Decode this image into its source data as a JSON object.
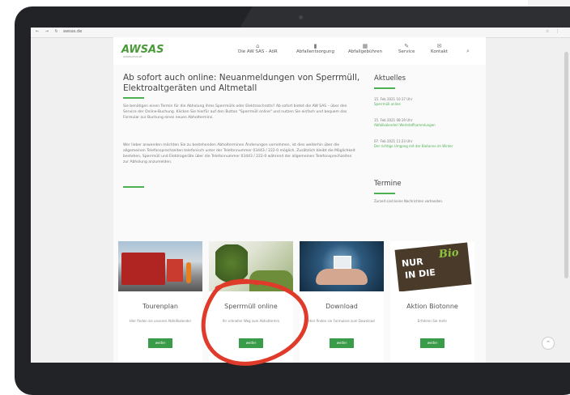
{
  "browser": {
    "nav_glyphs": "← → ↻",
    "url": "awsas.de",
    "ext_glyphs": "☆ ⋮"
  },
  "site": {
    "logo": "AWSAS",
    "logo_sub": "Abfallwirtschaft",
    "menu": [
      {
        "icon": "home-icon",
        "glyph": "⌂",
        "label": "Die AW SAS - AöR"
      },
      {
        "icon": "trash-icon",
        "glyph": "▮",
        "label": "Abfallentsorgung"
      },
      {
        "icon": "calendar-icon",
        "glyph": "▦",
        "label": "Abfallgebühren"
      },
      {
        "icon": "wrench-icon",
        "glyph": "✎",
        "label": "Service"
      },
      {
        "icon": "mail-icon",
        "glyph": "✉",
        "label": "Kontakt"
      }
    ],
    "search_glyph": "⌕"
  },
  "main": {
    "headline": "Ab sofort auch online: Neuanmeldungen von Sperrmüll, Elektroaltgeräten und Altmetall",
    "para1": "Sie benötigen einen Termin für die Abholung ihres Sperrmülls oder Elektroschrotts? Ab sofort bietet die AW SAS – über den Service der Online-Buchung. Klicken Sie hierfür auf den Button \"Sperrmüll online\" und nutzen Sie einfach und bequem das Formular zur Buchung eines neuen Abholtermins.",
    "para2": "Wer lieber anwenden möchten Sie zu bestehenden Abholterminen Änderungen vornehmen, ist dies weiterhin über die allgemeinen Telefonsprechzeiten telefonisch unter der Telefonnummer 03443 / 222-0 möglich. Zusätzlich bleibt die Möglichkeit bestehen, Sperrmüll und Elektrogeräte über die Telefonnummer 03443 / 222-0 während der allgemeinen Telefonsprechzeiten zur Abholung anzumelden."
  },
  "sidebar": {
    "aktuelles_title": "Aktuelles",
    "news": [
      {
        "date": "15. Feb 2021 10:17 Uhr",
        "title": "Sperrmüll online"
      },
      {
        "date": "15. Feb 2021 08:19 Uhr",
        "title": "Abfallkalender/ Wertstoffsammlungen"
      },
      {
        "date": "07. Feb 2021 11:23 Uhr",
        "title": "Der richtige Umgang mit der Biotonne im Winter"
      }
    ],
    "termine_title": "Termine",
    "termine_empty": "Zurzeit sind keine Nachrichten vorhanden."
  },
  "cards": [
    {
      "title": "Tourenplan",
      "desc": "Hier finden sie unseren Abfallkalender",
      "button": "weiter"
    },
    {
      "title": "Sperrmüll online",
      "desc": "Ihr schneller Weg zum Abholtermin",
      "button": "weiter"
    },
    {
      "title": "Download",
      "desc": "Hier finden sie Formulare zum Download",
      "button": "weiter"
    },
    {
      "title": "Aktion Biotonne",
      "desc": "Erfahren Sie mehr",
      "button": "weiter"
    }
  ],
  "biotonne_image": {
    "line1": "NUR",
    "line2": "IN DIE",
    "word": "Bio"
  },
  "scroll_up_glyph": "⌃",
  "colors": {
    "accent": "#4caf50",
    "button": "#3a9b48",
    "highlight_circle": "#e03a2a"
  }
}
